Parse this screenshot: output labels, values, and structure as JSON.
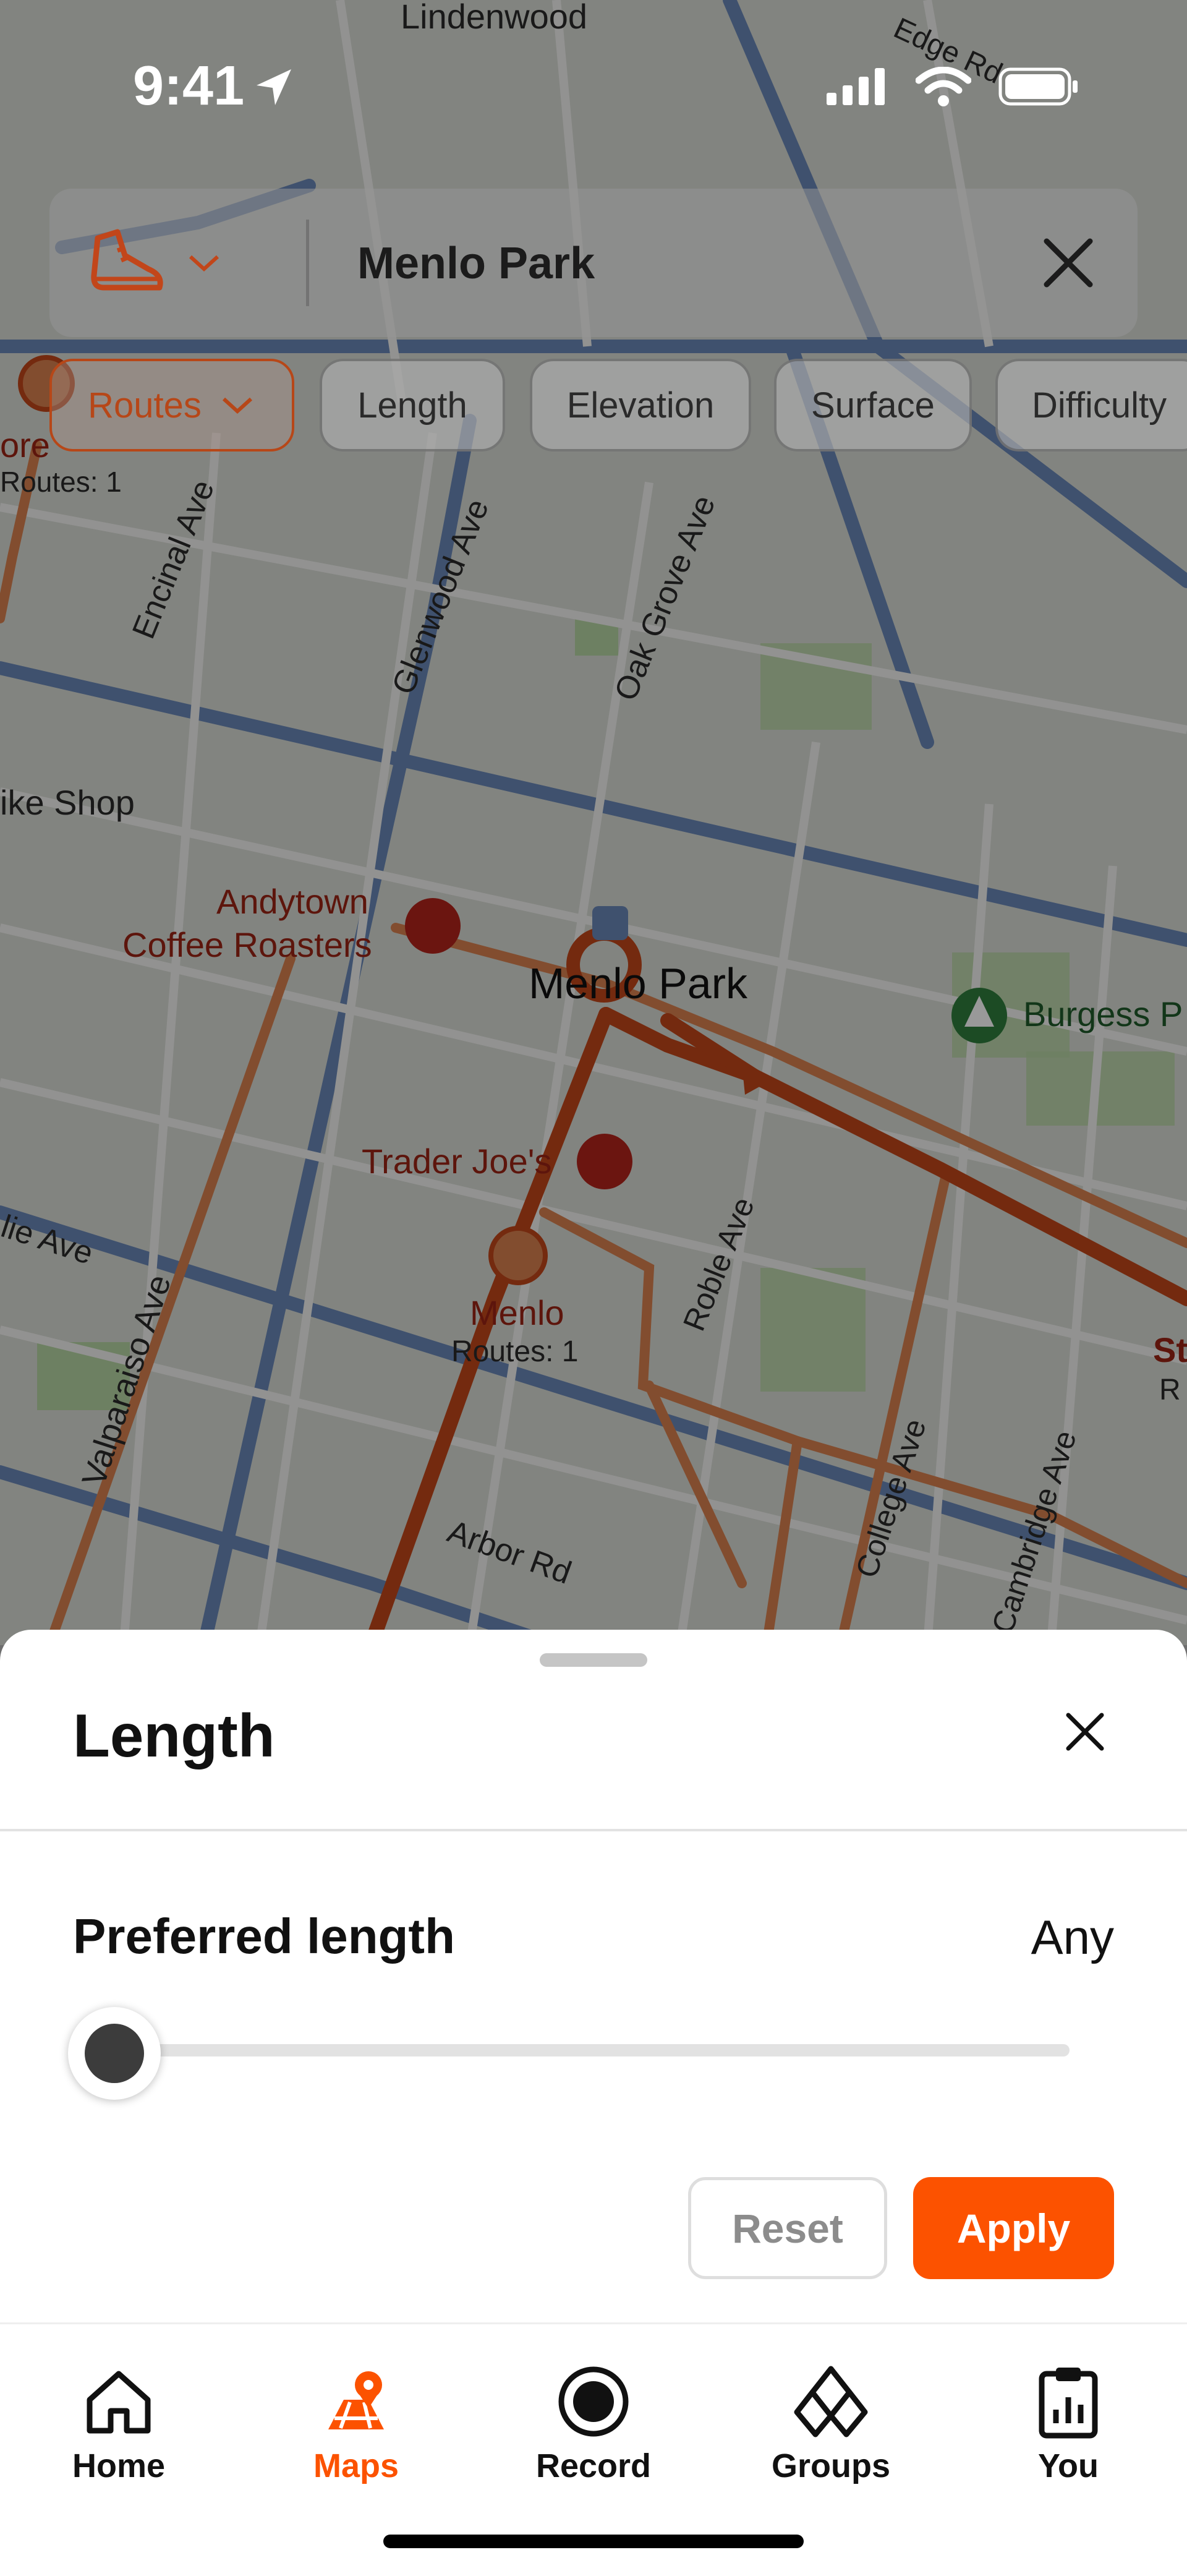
{
  "status_bar": {
    "time": "9:41"
  },
  "search": {
    "sport_icon": "running-shoe-icon",
    "query": "Menlo Park"
  },
  "chips": [
    {
      "label": "Routes",
      "active": true
    },
    {
      "label": "Length",
      "active": false
    },
    {
      "label": "Elevation",
      "active": false
    },
    {
      "label": "Surface",
      "active": false
    },
    {
      "label": "Difficulty",
      "active": false
    }
  ],
  "map": {
    "labels": {
      "lindenwood": "Lindenwood",
      "edge_rd": "Edge Rd",
      "encinal_ave": "Encinal Ave",
      "glenwood_ave": "Glenwood Ave",
      "oak_grove_ave": "Oak Grove Ave",
      "bike_shop": "ike Shop",
      "andytown_1": "Andytown",
      "andytown_2": "Coffee Roasters",
      "menlo_park": "Menlo Park",
      "burgess": "Burgess P",
      "trader_joes": "Trader Joe's",
      "menlo": "Menlo",
      "menlo_routes": "Routes: 1",
      "routes_top": "Routes: 1",
      "ore": "ore",
      "roble_ave": "Roble Ave",
      "valparaiso_ave": "Valparaiso Ave",
      "arbor_rd": "Arbor Rd",
      "college_ave": "College Ave",
      "cambridge_ave": "Cambridge Ave",
      "lie_ave": "lie Ave",
      "st": "St",
      "re": "R"
    }
  },
  "sheet": {
    "title": "Length",
    "preferred_label": "Preferred length",
    "preferred_value": "Any",
    "slider_level": 0,
    "reset_label": "Reset",
    "apply_label": "Apply"
  },
  "tabs": [
    {
      "label": "Home",
      "icon": "home-icon",
      "active": false
    },
    {
      "label": "Maps",
      "icon": "maps-icon",
      "active": true
    },
    {
      "label": "Record",
      "icon": "record-icon",
      "active": false
    },
    {
      "label": "Groups",
      "icon": "groups-icon",
      "active": false
    },
    {
      "label": "You",
      "icon": "clipboard-icon",
      "active": false
    }
  ],
  "colors": {
    "accent": "#fc5200",
    "route": "#c2461a",
    "route_light": "#d9804f"
  }
}
